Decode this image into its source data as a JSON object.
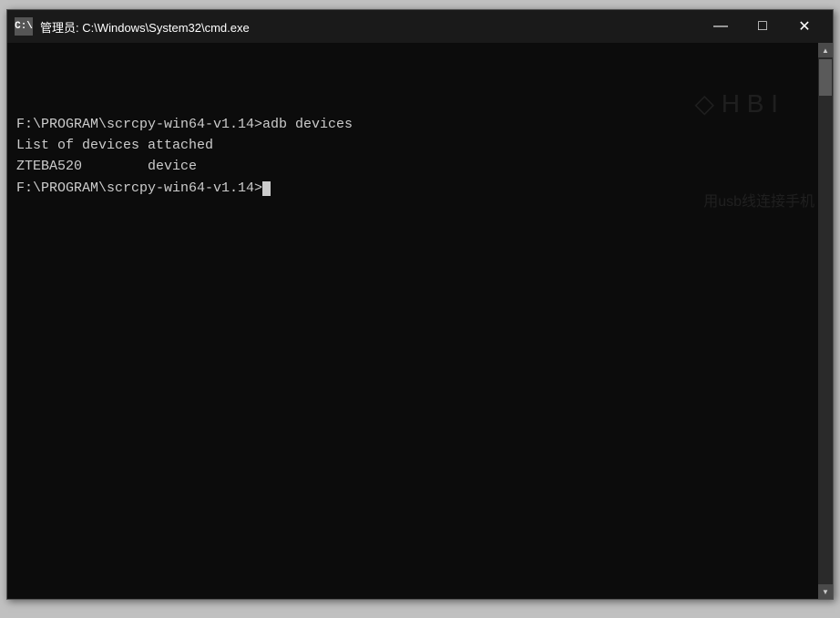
{
  "window": {
    "title": "管理员: C:\\Windows\\System32\\cmd.exe",
    "icon_label": "C:\\",
    "minimize_label": "—",
    "maximize_label": "□",
    "close_label": "✕"
  },
  "terminal": {
    "line1": "F:\\PROGRAM\\scrcpy-win64-v1.14>adb devices",
    "line2": "List of devices attached",
    "line3": "ZTEBA520        device",
    "line4": "",
    "line5": "F:\\PROGRAM\\scrcpy-win64-v1.14>"
  },
  "bleed": {
    "text1": "用usb线连接手机",
    "icons": "◇  H  B  I"
  }
}
